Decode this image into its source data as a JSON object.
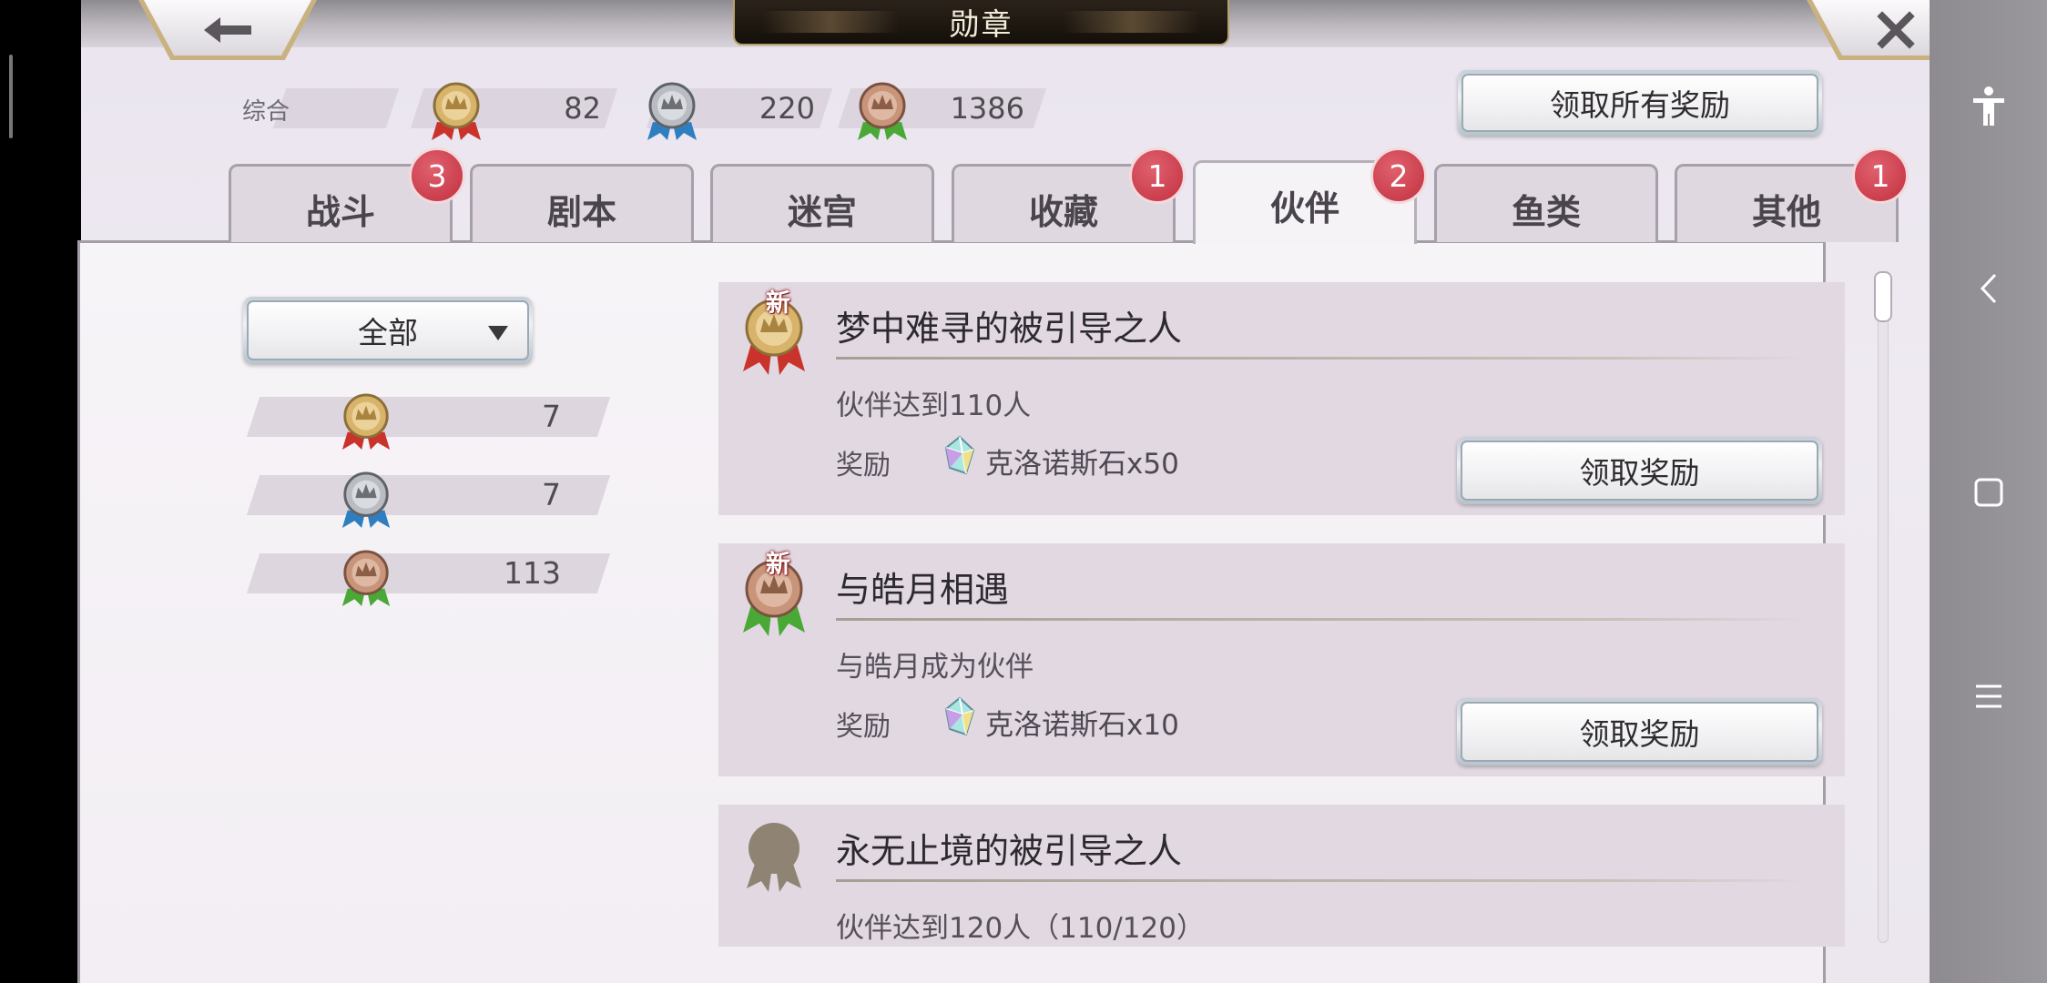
{
  "window": {
    "title": "勋章"
  },
  "summary": {
    "label": "综合",
    "gold": "82",
    "silver": "220",
    "bronze": "1386"
  },
  "claim_all_label": "领取所有奖励",
  "tabs": [
    {
      "label": "战斗",
      "badge": "3"
    },
    {
      "label": "剧本",
      "badge": ""
    },
    {
      "label": "迷宫",
      "badge": ""
    },
    {
      "label": "收藏",
      "badge": "1"
    },
    {
      "label": "伙伴",
      "badge": "2",
      "active": true
    },
    {
      "label": "鱼类",
      "badge": ""
    },
    {
      "label": "其他",
      "badge": "1"
    }
  ],
  "filter": {
    "selected": "全部"
  },
  "counts": {
    "gold": "7",
    "silver": "7",
    "bronze": "113"
  },
  "cards": [
    {
      "new": "新",
      "title": "梦中难寻的被引导之人",
      "desc": "伙伴达到110人",
      "reward_label": "奖励",
      "reward": "克洛诺斯石x50",
      "claim": "领取奖励",
      "medal": "gold"
    },
    {
      "new": "新",
      "title": "与皓月相遇",
      "desc": "与皓月成为伙伴",
      "reward_label": "奖励",
      "reward": "克洛诺斯石x10",
      "claim": "领取奖励",
      "medal": "bronze"
    },
    {
      "title": "永无止境的被引导之人",
      "desc": "伙伴达到120人（110/120）",
      "medal": "locked"
    }
  ],
  "colors": {
    "gold": "#d8b46a",
    "silver": "#b9bcc2",
    "bronze": "#c9957a",
    "ribbon_red": "#c9332b",
    "ribbon_blue": "#2f7fc0",
    "ribbon_green": "#4aa836",
    "badge_red": "#c8343f",
    "accent_gold": "#b9a06b"
  },
  "icons": {
    "back": "arrow-left-icon",
    "close": "close-x-icon",
    "accessibility": "accessibility-icon",
    "nav_back": "nav-back-icon",
    "nav_home": "nav-home-icon",
    "nav_menu": "nav-menu-icon",
    "dropdown": "triangle-down-icon",
    "crystal": "crystal-icon"
  }
}
